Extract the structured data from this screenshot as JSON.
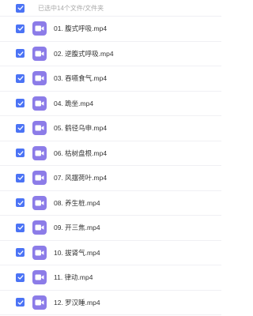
{
  "header": {
    "selection_text": "已选中14个文件/文件夹"
  },
  "colors": {
    "checkbox": "#4b73f5",
    "video_icon": "#8c7ce8"
  },
  "files": [
    {
      "name": "01. 腹式呼吸.mp4",
      "checked": true,
      "icon": "video-file-icon"
    },
    {
      "name": "02. 逆腹式呼吸.mp4",
      "checked": true,
      "icon": "video-file-icon"
    },
    {
      "name": "03. 吞嚥食气.mp4",
      "checked": true,
      "icon": "video-file-icon"
    },
    {
      "name": "04. 跪坐.mp4",
      "checked": true,
      "icon": "video-file-icon"
    },
    {
      "name": "05. 鹤径乌申.mp4",
      "checked": true,
      "icon": "video-file-icon"
    },
    {
      "name": "06. 枯树盘根.mp4",
      "checked": true,
      "icon": "video-file-icon"
    },
    {
      "name": "07. 风摆荷叶.mp4",
      "checked": true,
      "icon": "video-file-icon"
    },
    {
      "name": "08. 养生桩.mp4",
      "checked": true,
      "icon": "video-file-icon"
    },
    {
      "name": "09. 开三焦.mp4",
      "checked": true,
      "icon": "video-file-icon"
    },
    {
      "name": "10. 拔肾气.mp4",
      "checked": true,
      "icon": "video-file-icon"
    },
    {
      "name": "11. 律动.mp4",
      "checked": true,
      "icon": "video-file-icon"
    },
    {
      "name": "12. 罗汉睡.mp4",
      "checked": true,
      "icon": "video-file-icon"
    }
  ]
}
